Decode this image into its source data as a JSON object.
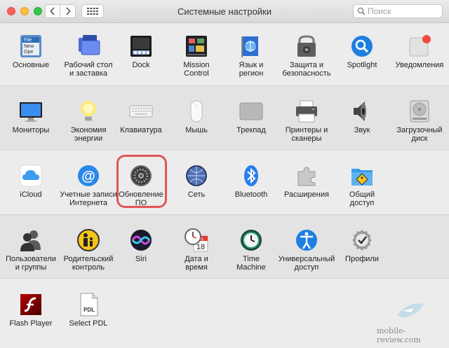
{
  "window": {
    "title": "Системные настройки"
  },
  "search": {
    "placeholder": "Поиск"
  },
  "rows": [
    {
      "items": [
        {
          "name": "general",
          "l1": "Основные",
          "l2": ""
        },
        {
          "name": "desktop-screensaver",
          "l1": "Рабочий стол",
          "l2": "и заставка"
        },
        {
          "name": "dock",
          "l1": "Dock",
          "l2": ""
        },
        {
          "name": "mission-control",
          "l1": "Mission",
          "l2": "Control"
        },
        {
          "name": "language-region",
          "l1": "Язык и",
          "l2": "регион"
        },
        {
          "name": "security",
          "l1": "Защита и",
          "l2": "безопасность"
        },
        {
          "name": "spotlight",
          "l1": "Spotlight",
          "l2": ""
        },
        {
          "name": "notifications",
          "l1": "Уведомления",
          "l2": ""
        }
      ]
    },
    {
      "items": [
        {
          "name": "displays",
          "l1": "Мониторы",
          "l2": ""
        },
        {
          "name": "energy",
          "l1": "Экономия",
          "l2": "энергии"
        },
        {
          "name": "keyboard",
          "l1": "Клавиатура",
          "l2": ""
        },
        {
          "name": "mouse",
          "l1": "Мышь",
          "l2": ""
        },
        {
          "name": "trackpad",
          "l1": "Трекпад",
          "l2": ""
        },
        {
          "name": "printers",
          "l1": "Принтеры и",
          "l2": "сканеры"
        },
        {
          "name": "sound",
          "l1": "Звук",
          "l2": ""
        },
        {
          "name": "startup-disk",
          "l1": "Загрузочный",
          "l2": "диск"
        }
      ]
    },
    {
      "items": [
        {
          "name": "icloud",
          "l1": "iCloud",
          "l2": ""
        },
        {
          "name": "internet-accounts",
          "l1": "Учетные записи",
          "l2": "Интернета"
        },
        {
          "name": "software-update",
          "l1": "Обновление",
          "l2": "ПО"
        },
        {
          "name": "network",
          "l1": "Сеть",
          "l2": ""
        },
        {
          "name": "bluetooth",
          "l1": "Bluetooth",
          "l2": ""
        },
        {
          "name": "extensions",
          "l1": "Расширения",
          "l2": ""
        },
        {
          "name": "sharing",
          "l1": "Общий",
          "l2": "доступ"
        }
      ]
    },
    {
      "items": [
        {
          "name": "users-groups",
          "l1": "Пользователи",
          "l2": "и группы"
        },
        {
          "name": "parental-controls",
          "l1": "Родительский",
          "l2": "контроль"
        },
        {
          "name": "siri",
          "l1": "Siri",
          "l2": ""
        },
        {
          "name": "date-time",
          "l1": "Дата и",
          "l2": "время"
        },
        {
          "name": "time-machine",
          "l1": "Time",
          "l2": "Machine"
        },
        {
          "name": "accessibility",
          "l1": "Универсальный",
          "l2": "доступ"
        },
        {
          "name": "profiles",
          "l1": "Профили",
          "l2": ""
        }
      ]
    },
    {
      "items": [
        {
          "name": "flash-player",
          "l1": "Flash Player",
          "l2": ""
        },
        {
          "name": "select-pdl",
          "l1": "Select PDL",
          "l2": ""
        }
      ]
    }
  ],
  "icon_labels": {
    "general": "File\nNew\nOpe",
    "calendar_day": "18",
    "calendar_month": "JUL",
    "pdl": "PDL"
  },
  "watermark": "mobile-review.com"
}
